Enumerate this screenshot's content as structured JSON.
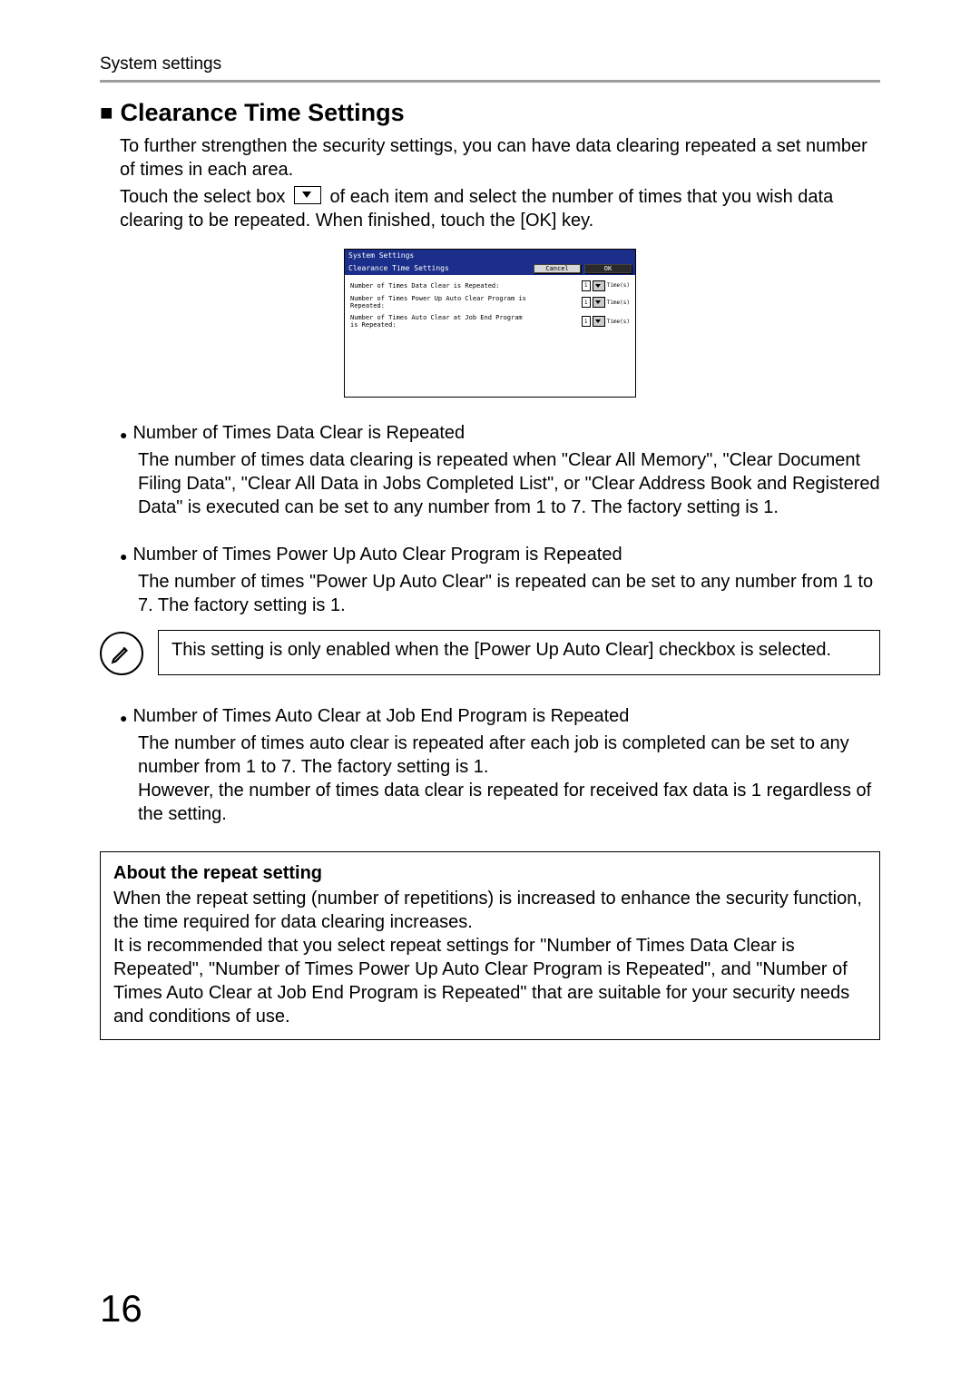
{
  "header": {
    "section": "System settings"
  },
  "heading": {
    "marker": "■",
    "title": "Clearance Time Settings"
  },
  "intro": {
    "p1": "To further strengthen the security settings, you can have data clearing repeated a set number of times in each area.",
    "p2a": "Touch the select box",
    "p2b": "of each item and select the number of times that you wish data clearing to be repeated. When finished, touch the [OK] key."
  },
  "screenshot": {
    "window_title": "System Settings",
    "panel_title": "Clearance Time Settings",
    "cancel": "Cancel",
    "ok": "OK",
    "rows": [
      {
        "label": "Number of Times Data Clear is Repeated:",
        "value": "1",
        "unit": "Time(s)"
      },
      {
        "label": "Number of Times Power Up Auto Clear Program is Repeated:",
        "value": "1",
        "unit": "Time(s)"
      },
      {
        "label": "Number of Times Auto Clear at Job End Program is Repeated:",
        "value": "1",
        "unit": "Time(s)"
      }
    ]
  },
  "items": [
    {
      "title": "Number of Times Data Clear is Repeated",
      "body": "The number of times data clearing is repeated when \"Clear All Memory\", \"Clear Document Filing Data\", \"Clear All Data in Jobs Completed List\", or \"Clear Address Book and Registered Data\" is executed can be set to any number from 1 to 7. The factory setting is 1."
    },
    {
      "title": "Number of Times Power Up Auto Clear Program is Repeated",
      "body": "The number of times \"Power Up Auto Clear\" is repeated can be set to any number from 1 to 7. The factory setting is 1."
    },
    {
      "title": "Number of Times Auto Clear at Job End Program is Repeated",
      "body": "The number of times auto clear is repeated after each job is completed can be set to any number from 1 to 7. The factory setting is 1.\nHowever, the number of times data clear is repeated for received fax data is 1 regardless of the setting."
    }
  ],
  "note": {
    "text": "This setting is only enabled when the [Power Up Auto Clear] checkbox is selected."
  },
  "about": {
    "title": "About the repeat setting",
    "p1": "When the repeat setting (number of repetitions) is increased to enhance the security function, the time required for data clearing increases.",
    "p2": "It is recommended that you select repeat settings for \"Number of Times Data Clear is Repeated\", \"Number of Times Power Up Auto Clear Program is Repeated\", and \"Number of Times Auto Clear at Job End Program is Repeated\" that are suitable for your security needs and conditions of use."
  },
  "page_number": "16"
}
